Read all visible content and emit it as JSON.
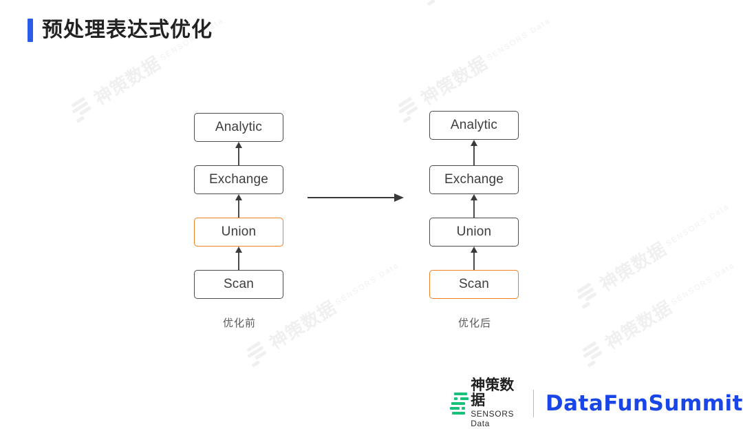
{
  "page": {
    "title": "预处理表达式优化",
    "accent_color": "#2a5ce8",
    "background": "#ffffff"
  },
  "diagram": {
    "type": "flow-comparison",
    "node_border_color": "#4a4a4a",
    "highlight_color": "#ed8022",
    "transform_arrow": "arrow-right",
    "columns": [
      {
        "id": "before",
        "caption": "优化前",
        "nodes": [
          {
            "label": "Analytic",
            "highlighted": false
          },
          {
            "label": "Exchange",
            "highlighted": false
          },
          {
            "label": "Union",
            "highlighted": true
          },
          {
            "label": "Scan",
            "highlighted": false
          }
        ]
      },
      {
        "id": "after",
        "caption": "优化后",
        "nodes": [
          {
            "label": "Analytic",
            "highlighted": false
          },
          {
            "label": "Exchange",
            "highlighted": false
          },
          {
            "label": "Union",
            "highlighted": false
          },
          {
            "label": "Scan",
            "highlighted": true
          }
        ]
      }
    ]
  },
  "footer": {
    "sensors_cn": "神策数据",
    "sensors_en": "SENSORS Data",
    "sensors_color": "#18c07a",
    "summit_text": "DataFunSummit",
    "summit_color": "#1a46e8"
  },
  "watermark": {
    "cn": "神策数据",
    "en": "SENSORS Data",
    "color": "#f0f0f0"
  }
}
